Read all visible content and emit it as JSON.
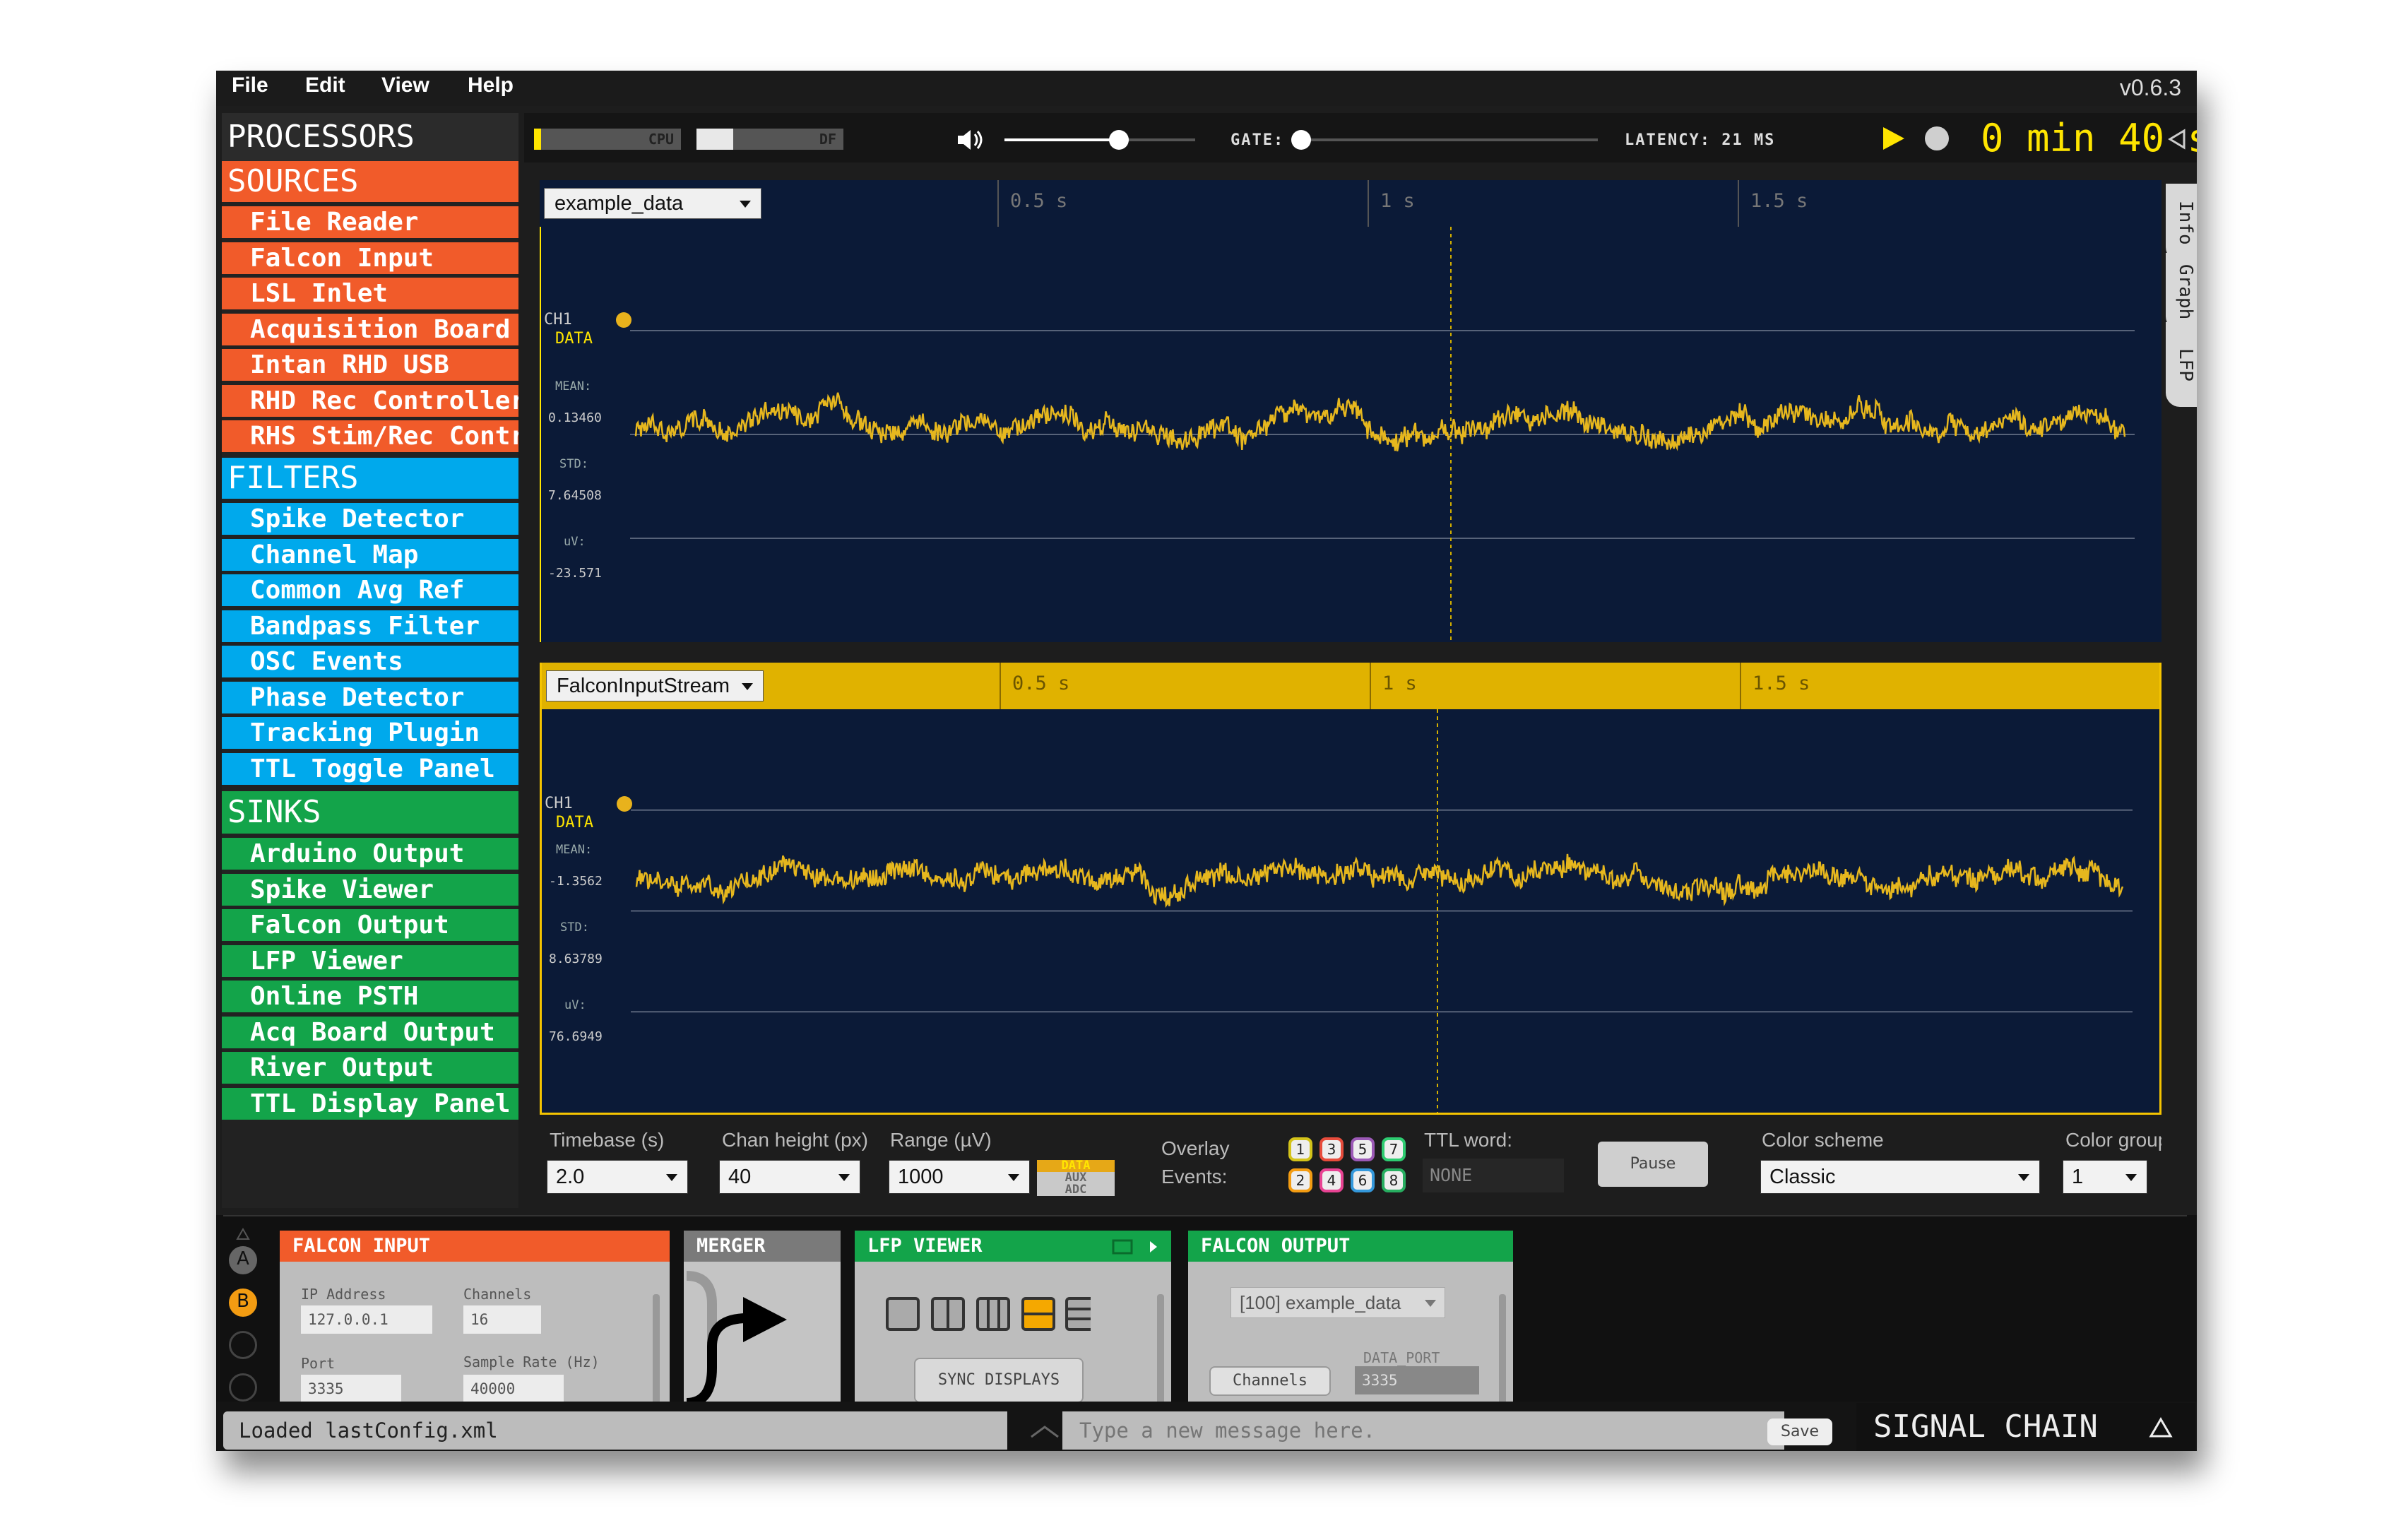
{
  "menu": {
    "file": "File",
    "edit": "Edit",
    "view": "View",
    "help": "Help",
    "version": "v0.6.3"
  },
  "processors": {
    "title": "PROCESSORS",
    "sources": {
      "label": "SOURCES",
      "color": "#f15b2a",
      "items": [
        "File Reader",
        "Falcon Input",
        "LSL Inlet",
        "Acquisition Board",
        "Intan RHD USB",
        "RHD Rec Controller",
        "RHS Stim/Rec Controller"
      ]
    },
    "filters": {
      "label": "FILTERS",
      "color": "#00a9ec",
      "items": [
        "Spike Detector",
        "Channel Map",
        "Common Avg Ref",
        "Bandpass Filter",
        "OSC Events",
        "Phase Detector",
        "Tracking Plugin",
        "TTL Toggle Panel"
      ]
    },
    "sinks": {
      "label": "SINKS",
      "color": "#13a44a",
      "items": [
        "Arduino Output",
        "Spike Viewer",
        "Falcon Output",
        "LFP Viewer",
        "Online PSTH",
        "Acq Board Output",
        "River Output",
        "TTL Display Panel"
      ]
    }
  },
  "control": {
    "cpu_label": "CPU",
    "cpu_level": 0.05,
    "df_label": "DF",
    "df_level": 0.25,
    "volume_level": 0.6,
    "gate_label": "GATE:",
    "gate_level": 0.0,
    "latency": "LATENCY: 21 MS",
    "time_min": "0",
    "min_label": "min",
    "time_sec": "40",
    "sec_label": "s",
    "accent": "#ffe500"
  },
  "display1": {
    "stream": "example_data",
    "ticks": [
      "0.5 s",
      "1 s",
      "1.5 s"
    ],
    "channel": "CH1",
    "channel_sub": "DATA",
    "mean_label": "MEAN:",
    "mean": "0.13460",
    "std_label": "STD:",
    "std": "7.64508",
    "uv_label": "uV:",
    "uv": "-23.571",
    "trace_color": "#e6b71e",
    "bar_color": "#2a2a2a"
  },
  "display2": {
    "stream": "FalconInputStream",
    "ticks": [
      "0.5 s",
      "1 s",
      "1.5 s"
    ],
    "channel": "CH1",
    "channel_sub": "DATA",
    "mean_label": "MEAN:",
    "mean": "-1.3562",
    "std_label": "STD:",
    "std": "8.63789",
    "uv_label": "uV:",
    "uv": "76.6949",
    "trace_color": "#e6b71e",
    "bar_color": "#e0b200"
  },
  "options": {
    "timebase_label": "Timebase (s)",
    "timebase": "2.0",
    "chan_height_label": "Chan height (px)",
    "chan_height": "40",
    "range_label": "Range (µV)",
    "range": "1000",
    "data_label": "DATA",
    "aux_label": "AUX",
    "adc_label": "ADC",
    "overlay_label": "Overlay",
    "events_label": "Events:",
    "events_top": [
      "1",
      "3",
      "5",
      "7"
    ],
    "events_bottom": [
      "2",
      "4",
      "6",
      "8"
    ],
    "ttl_label": "TTL word:",
    "ttl_value": "NONE",
    "pause_label": "Pause",
    "color_scheme_label": "Color scheme",
    "color_scheme": "Classic",
    "color_group_label": "Color group",
    "color_group": "1"
  },
  "side_tabs": [
    "Info",
    "Graph",
    "LFP"
  ],
  "chain": {
    "dot_a": "A",
    "dot_b": "B",
    "falcon_input": {
      "title": "FALCON INPUT",
      "ip_label": "IP Address",
      "ip": "127.0.0.1",
      "channels_label": "Channels",
      "channels": "16",
      "port_label": "Port",
      "port": "3335",
      "rate_label": "Sample Rate (Hz)",
      "rate": "40000"
    },
    "merger": {
      "title": "MERGER"
    },
    "lfp_viewer": {
      "title": "LFP VIEWER",
      "sync_label": "SYNC DISPLAYS"
    },
    "falcon_output": {
      "title": "FALCON OUTPUT",
      "stream": "[100] example_data",
      "data_port_label": "DATA_PORT",
      "data_port": "3335",
      "channels_label": "Channels"
    }
  },
  "status": {
    "message": "Loaded lastConfig.xml",
    "placeholder": "Type a new message here.",
    "save": "Save",
    "signal_chain": "SIGNAL CHAIN"
  }
}
